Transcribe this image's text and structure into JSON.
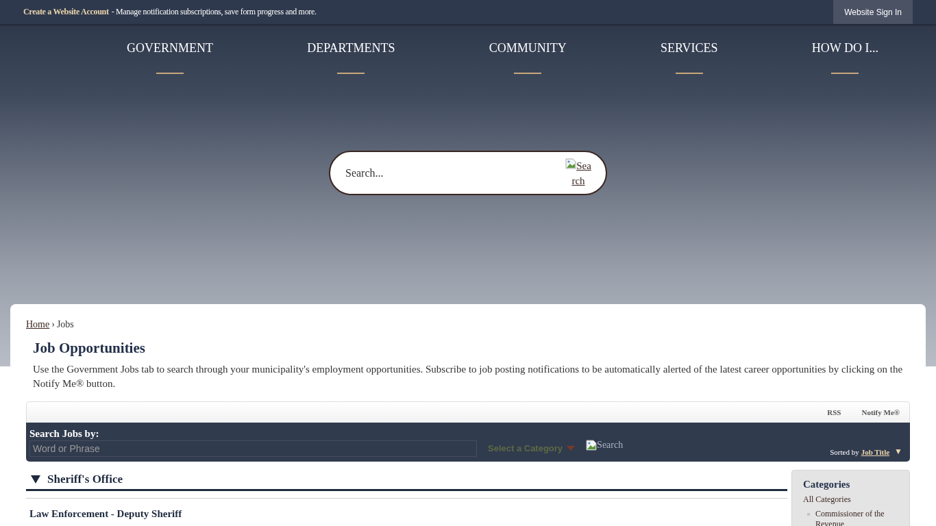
{
  "top_bar": {
    "account_link": "Create a Website Account",
    "account_text": "- Manage notification subscriptions, save form progress and more.",
    "sign_in": "Website Sign In"
  },
  "nav": [
    "GOVERNMENT",
    "DEPARTMENTS",
    "COMMUNITY",
    "SERVICES",
    "HOW DO I..."
  ],
  "search": {
    "placeholder": "Search...",
    "button": "Search"
  },
  "breadcrumb": {
    "home": "Home",
    "separator": "›",
    "current": "Jobs"
  },
  "page": {
    "title": "Job Opportunities",
    "intro": "Use the Government Jobs tab to search through your municipality's employment opportunities. Subscribe to job posting notifications to be automatically alerted of the latest career opportunities by clicking on the Notify Me® button."
  },
  "toolbar": [
    "RSS",
    "Notify Me®"
  ],
  "job_search": {
    "label": "Search Jobs by:",
    "placeholder": "Word or Phrase",
    "category": "Select a Category",
    "button": "Search",
    "sorted_by": "Sorted by",
    "sort_field": "Job Title",
    "sort_arrow": "▼"
  },
  "groups": [
    {
      "name": "Sheriff's Office",
      "expanded": true,
      "jobs": [
        "Law Enforcement - Deputy Sheriff"
      ]
    }
  ],
  "categories": {
    "title": "Categories",
    "all": "All Categories",
    "items": [
      "Commissioner of the Revenue"
    ]
  }
}
